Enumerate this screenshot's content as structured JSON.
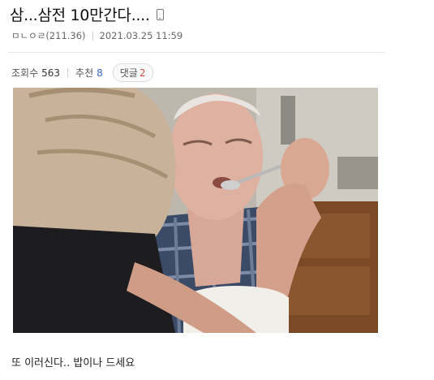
{
  "post": {
    "title": "삼...삼전 10만간다....",
    "author": "ㅁㄴㅇㄹ(211.36)",
    "datetime": "2021.03.25 11:59"
  },
  "stats": {
    "views_label": "조회수",
    "views": "563",
    "recommend_label": "추천",
    "recommend": "8",
    "comments_label": "댓글",
    "comments": "2"
  },
  "body": {
    "caption": "또 이러신다.. 밥이나 드세요"
  },
  "colors": {
    "recommend": "#3a63c8",
    "comment_count": "#d94b4b"
  },
  "icons": [
    "mobile-icon"
  ]
}
